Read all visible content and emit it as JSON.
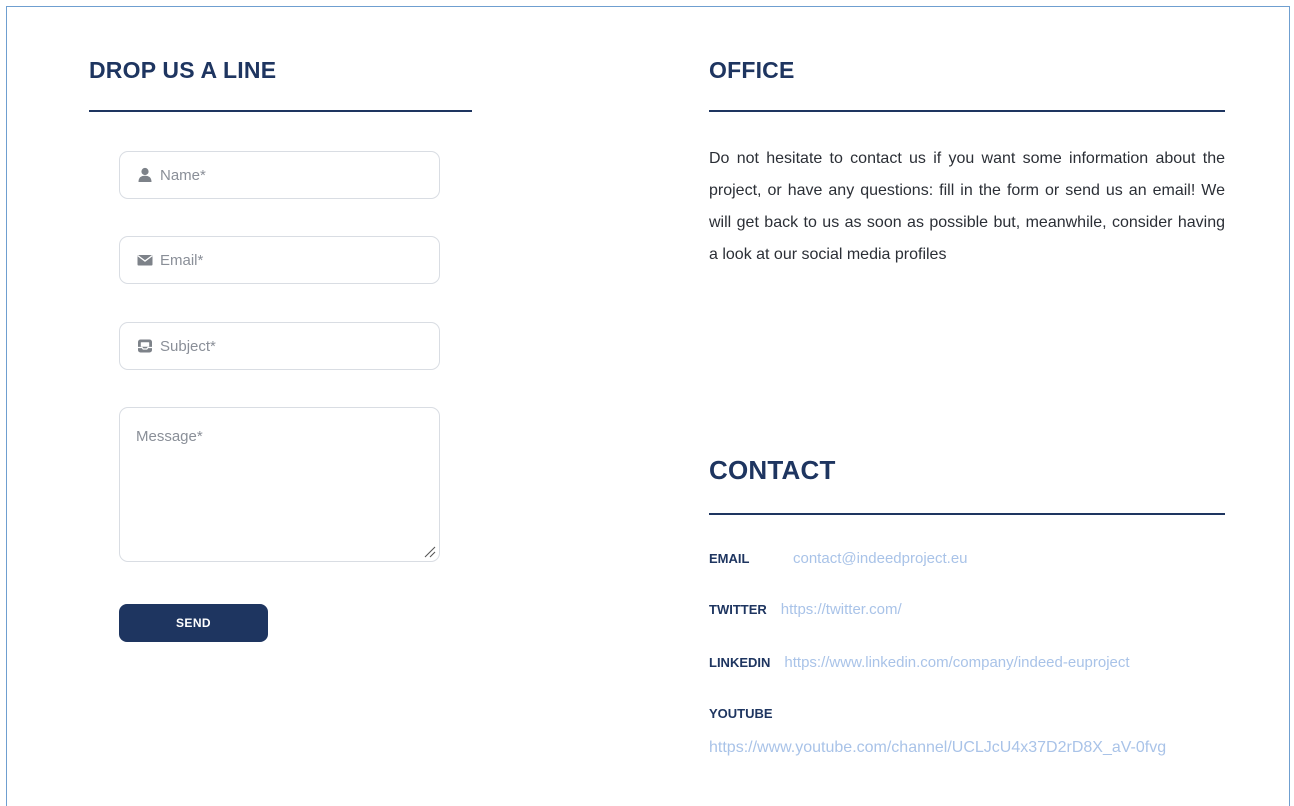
{
  "form": {
    "title": "DROP US A LINE",
    "fields": {
      "name": {
        "placeholder": "Name*",
        "icon": "user-icon"
      },
      "email": {
        "placeholder": "Email*",
        "icon": "envelope-icon"
      },
      "subject": {
        "placeholder": "Subject*",
        "icon": "envelope-open-icon"
      },
      "message": {
        "placeholder": "Message*"
      }
    },
    "send_label": "SEND"
  },
  "office": {
    "title": "OFFICE",
    "text": "Do not hesitate to contact us if you want some information about the project, or have any questions: fill in the form or send us an email! We will get back to us as soon as possible but, meanwhile, consider having a look at our social media profiles"
  },
  "contact": {
    "title": "CONTACT",
    "email": {
      "label": "EMAIL",
      "value": "contact@indeedproject.eu"
    },
    "twitter": {
      "label": "TWITTER",
      "value": "https://twitter.com/"
    },
    "linkedin": {
      "label": "LINKEDIN",
      "value": "https://www.linkedin.com/company/indeed-euproject"
    },
    "youtube": {
      "label": "YOUTUBE",
      "value": "https://www.youtube.com/channel/UCLJcU4x37D2rD8X_aV-0fvg"
    }
  },
  "colors": {
    "primary": "#1e3560",
    "link": "#a9c3e8",
    "frame_border": "#6f9fd0"
  }
}
